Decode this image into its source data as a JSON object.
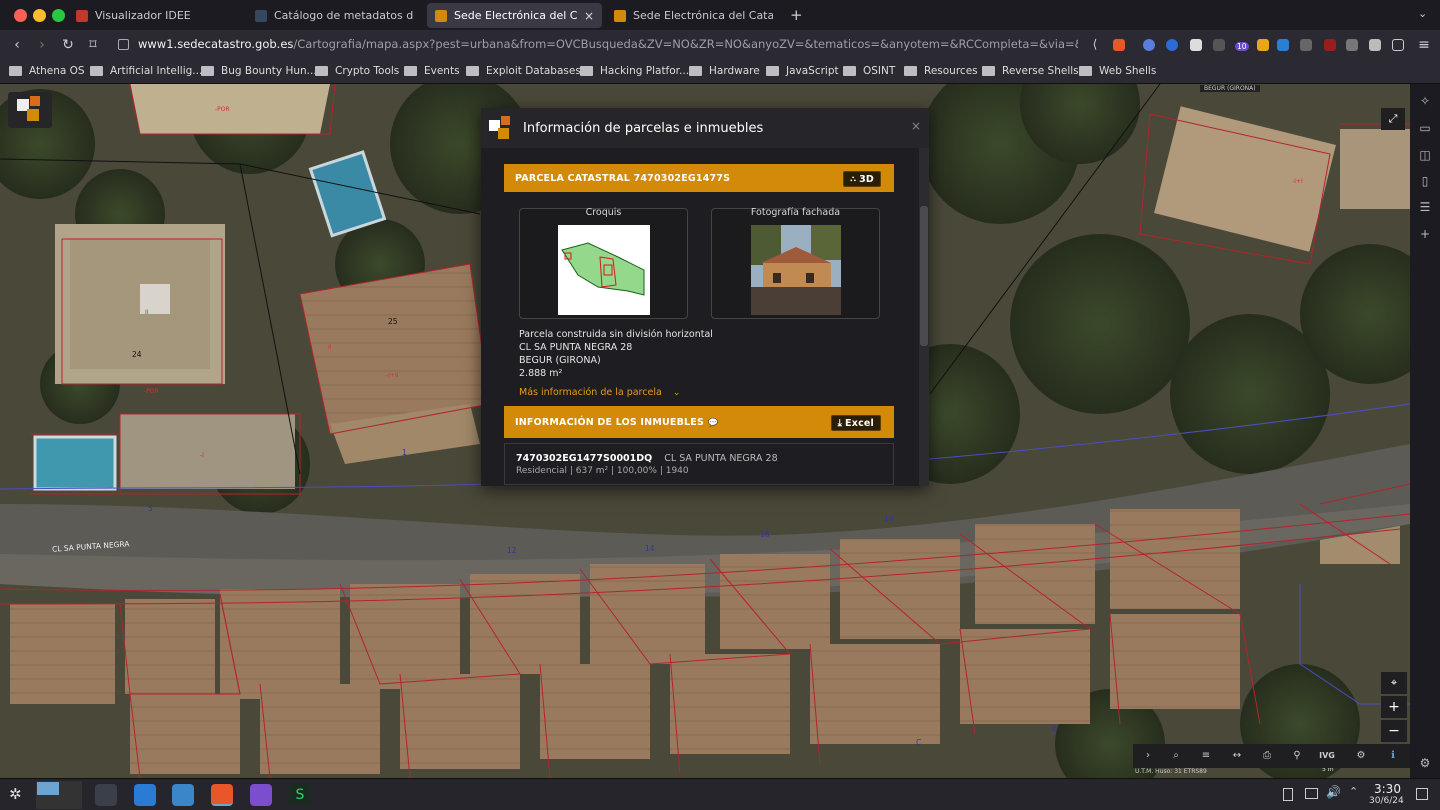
{
  "tabs": [
    {
      "title": "Visualizador IDEE",
      "favicon_color": "#c0392b"
    },
    {
      "title": "Catálogo de metadatos de la In",
      "favicon_color": "#2c3e50"
    },
    {
      "title": "Sede Electrónica del Catastr",
      "favicon_color": "#d28a08"
    },
    {
      "title": "Sede Electrónica del Catastro - C",
      "favicon_color": "#d28a08"
    }
  ],
  "new_tab": "+",
  "url": {
    "domain": "www1.sedecatastro.gob.es",
    "path": "/Cartografia/mapa.aspx?pest=urbana&from=OVCBusqueda&ZV=NO&ZR=NO&anyoZV=&tematicos=&anyotem=&RCCompleta=&via=&tipoVia=&numero=&kilome..."
  },
  "bookmarks": [
    "Athena OS",
    "Artificial Intellig...",
    "Bug Bounty Hun...",
    "Crypto Tools",
    "Events",
    "Exploit Databases",
    "Hacking Platfor...",
    "Hardware",
    "JavaScript",
    "OSINT",
    "Resources",
    "Reverse Shells",
    "Web Shells"
  ],
  "extension_badge": "10",
  "map_labels": {
    "street": "CL SA PUNTA NEGRA",
    "corner": "BEGUR (GIRONA)",
    "scale": "5 m",
    "utm": "U.T.M. Huso: 31 ETRS89",
    "parcels": [
      "25",
      "24",
      "-POR",
      "-POR",
      "II",
      "II",
      "-I+II",
      "-I",
      "1",
      "5",
      "B",
      "C",
      "12",
      "14",
      "16",
      "18",
      "-I+I"
    ]
  },
  "dialog": {
    "title": "Información de parcelas e inmuebles",
    "close": "×",
    "parcel_header": "PARCELA CATASTRAL 7470302EG1477S",
    "btn_3d": "3D",
    "croquis_label": "Croquis",
    "foto_label": "Fotografía fachada",
    "parcel_type": "Parcela construida sin división horizontal",
    "address": "CL SA PUNTA NEGRA 28",
    "municipality": "BEGUR (GIRONA)",
    "area": "2.888 m²",
    "more_info": "Más información de la parcela",
    "properties_header": "INFORMACIÓN DE LOS INMUEBLES",
    "excel": "Excel",
    "property": {
      "ref": "7470302EG1477S0001DQ",
      "address": "CL SA PUNTA NEGRA 28",
      "details": "Residencial | 637 m² | 100,00% | 1940"
    }
  },
  "map_controls": [
    "›",
    "⌕",
    "≡",
    "↔",
    "⎙",
    "⚲",
    "IVG",
    "⚙",
    "ℹ"
  ],
  "taskbar": {
    "time": "3:30",
    "date": "30/6/24"
  },
  "colors": {
    "accent": "#d28a08",
    "dialog_bg": "#26262a",
    "browser_bg": "#1c1b22"
  }
}
